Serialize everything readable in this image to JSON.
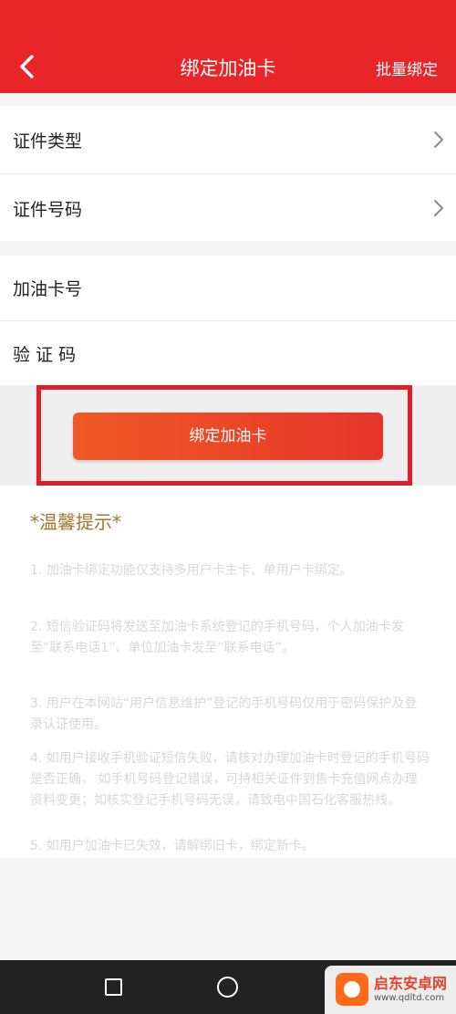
{
  "header": {
    "title": "绑定加油卡",
    "right_action": "批量绑定",
    "back_icon": "chevron-left-icon",
    "bg_color": "#e8262a"
  },
  "form": {
    "id_type": {
      "label": "证件类型",
      "icon": "chevron-right-icon"
    },
    "id_number": {
      "label": "证件号码",
      "icon": "chevron-right-icon"
    },
    "card_number": {
      "label": "加油卡号"
    },
    "verify_code": {
      "label": "验 证 码"
    }
  },
  "submit": {
    "label": "绑定加油卡",
    "highlight_color": "#e01e25"
  },
  "tips": {
    "title": "*温馨提示*",
    "items": [
      "1. 加油卡绑定功能仅支持多用户卡主卡、单用户卡绑定。",
      "2. 短信验证码将发送至加油卡系统登记的手机号码，个人加油卡发至“联系电话1”、单位加油卡发至“联系电话”。",
      "3. 用户在本网站“用户信息维护”登记的手机号码仅用于密码保护及登录认证使用。",
      "4. 如用户接收手机验证短信失败，请核对办理加油卡时登记的手机号码是否正确， 如手机号码登记错误，可持相关证件到售卡充值网点办理资料变更；如核实登记手机号码无误，请致电中国石化客服热线。",
      "5. 如用户加油卡已失效，请解绑旧卡，绑定新卡。"
    ]
  },
  "system_nav": {
    "recent_icon": "square-icon",
    "home_icon": "circle-icon"
  },
  "watermark": {
    "name": "启东安卓网",
    "url": "www.qdltd.com"
  }
}
